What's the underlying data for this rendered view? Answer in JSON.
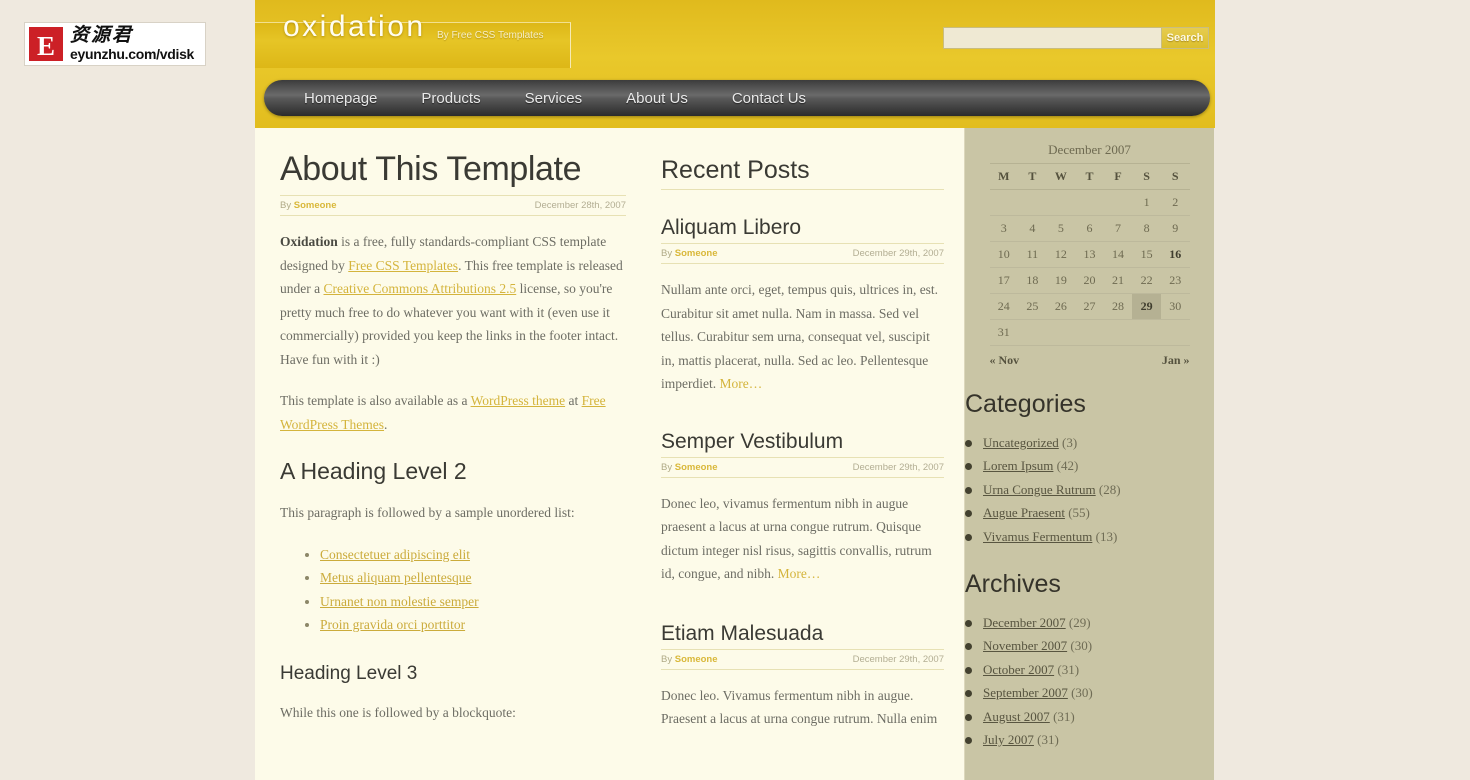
{
  "logo": {
    "badge_letter": "E",
    "chinese_name": "资源君",
    "url": "eyunzhu.com/vdisk"
  },
  "header": {
    "site_title": "oxidation",
    "site_subtitle": "By Free CSS Templates"
  },
  "search": {
    "value": "",
    "placeholder": "",
    "button_label": "Search"
  },
  "nav": {
    "items": [
      {
        "label": "Homepage"
      },
      {
        "label": "Products"
      },
      {
        "label": "Services"
      },
      {
        "label": "About Us"
      },
      {
        "label": "Contact Us"
      }
    ]
  },
  "article": {
    "title": "About This Template",
    "by_prefix": "By ",
    "author": "Someone",
    "date": "December 28th, 2007",
    "para1_strong": "Oxidation",
    "para1_a": " is a free, fully standards-compliant CSS template designed by ",
    "link_free_css": "Free CSS Templates",
    "para1_b": ". This free template is released under a ",
    "link_cc": "Creative Commons Attributions 2.5",
    "para1_c": " license, so you're pretty much free to do whatever you want with it (even use it commercially) provided you keep the links in the footer intact. Have fun with it :)",
    "para2_a": "This template is also available as a ",
    "link_wp_theme": "WordPress theme",
    "para2_b": " at ",
    "link_free_wp": "Free WordPress Themes",
    "para2_c": ".",
    "heading2": "A Heading Level 2",
    "para3": "This paragraph is followed by a sample unordered list:",
    "list": [
      "Consectetuer adipiscing elit",
      "Metus aliquam pellentesque",
      "Urnanet non molestie semper",
      "Proin gravida orci porttitor"
    ],
    "heading3": "Heading Level 3",
    "para4": "While this one is followed by a blockquote:"
  },
  "recent_posts": {
    "section_title": "Recent Posts",
    "posts": [
      {
        "title": "Aliquam Libero",
        "by_prefix": "By ",
        "author": "Someone",
        "date": "December 29th, 2007",
        "body": "Nullam ante orci, eget, tempus quis, ultrices in, est. Curabitur sit amet nulla. Nam in massa. Sed vel tellus. Curabitur sem urna, consequat vel, suscipit in, mattis placerat, nulla. Sed ac leo. Pellentesque imperdiet. ",
        "more_label": "More…"
      },
      {
        "title": "Semper Vestibulum",
        "by_prefix": "By ",
        "author": "Someone",
        "date": "December 29th, 2007",
        "body": "Donec leo, vivamus fermentum nibh in augue praesent a lacus at urna congue rutrum. Quisque dictum integer nisl risus, sagittis convallis, rutrum id, congue, and nibh. ",
        "more_label": "More…"
      },
      {
        "title": "Etiam Malesuada",
        "by_prefix": "By ",
        "author": "Someone",
        "date": "December 29th, 2007",
        "body": "Donec leo. Vivamus fermentum nibh in augue. Praesent a lacus at urna congue rutrum. Nulla enim",
        "more_label": ""
      }
    ]
  },
  "sidebar": {
    "calendar": {
      "caption": "December 2007",
      "weekdays": [
        "M",
        "T",
        "W",
        "T",
        "F",
        "S",
        "S"
      ],
      "weeks": [
        [
          "",
          "",
          "",
          "",
          "",
          "1",
          "2"
        ],
        [
          "3",
          "4",
          "5",
          "6",
          "7",
          "8",
          "9"
        ],
        [
          "10",
          "11",
          "12",
          "13",
          "14",
          "15",
          "16"
        ],
        [
          "17",
          "18",
          "19",
          "20",
          "21",
          "22",
          "23"
        ],
        [
          "24",
          "25",
          "26",
          "27",
          "28",
          "29",
          "30"
        ],
        [
          "31",
          "",
          "",
          "",
          "",
          "",
          ""
        ]
      ],
      "bold_day": "16",
      "today": "29",
      "prev_label": "« Nov",
      "next_label": "Jan »"
    },
    "categories": {
      "title": "Categories",
      "items": [
        {
          "label": "Uncategorized",
          "count": "(3)"
        },
        {
          "label": "Lorem Ipsum",
          "count": "(42)"
        },
        {
          "label": "Urna Congue Rutrum",
          "count": "(28)"
        },
        {
          "label": "Augue Praesent",
          "count": "(55)"
        },
        {
          "label": "Vivamus Fermentum",
          "count": "(13)"
        }
      ]
    },
    "archives": {
      "title": "Archives",
      "items": [
        {
          "label": "December 2007",
          "count": "(29)"
        },
        {
          "label": "November 2007",
          "count": "(30)"
        },
        {
          "label": "October 2007",
          "count": "(31)"
        },
        {
          "label": "September 2007",
          "count": "(30)"
        },
        {
          "label": "August 2007",
          "count": "(31)"
        },
        {
          "label": "July 2007",
          "count": "(31)"
        }
      ]
    }
  },
  "colors": {
    "header_gold": "#e8c425",
    "content_cream": "#fdfbe9",
    "sidebar_khaki": "#c9c5a5",
    "page_bg": "#efe9df",
    "link_gold": "#d4b43c",
    "nav_dark": "#3c3c3c",
    "logo_red": "#cc2026"
  }
}
